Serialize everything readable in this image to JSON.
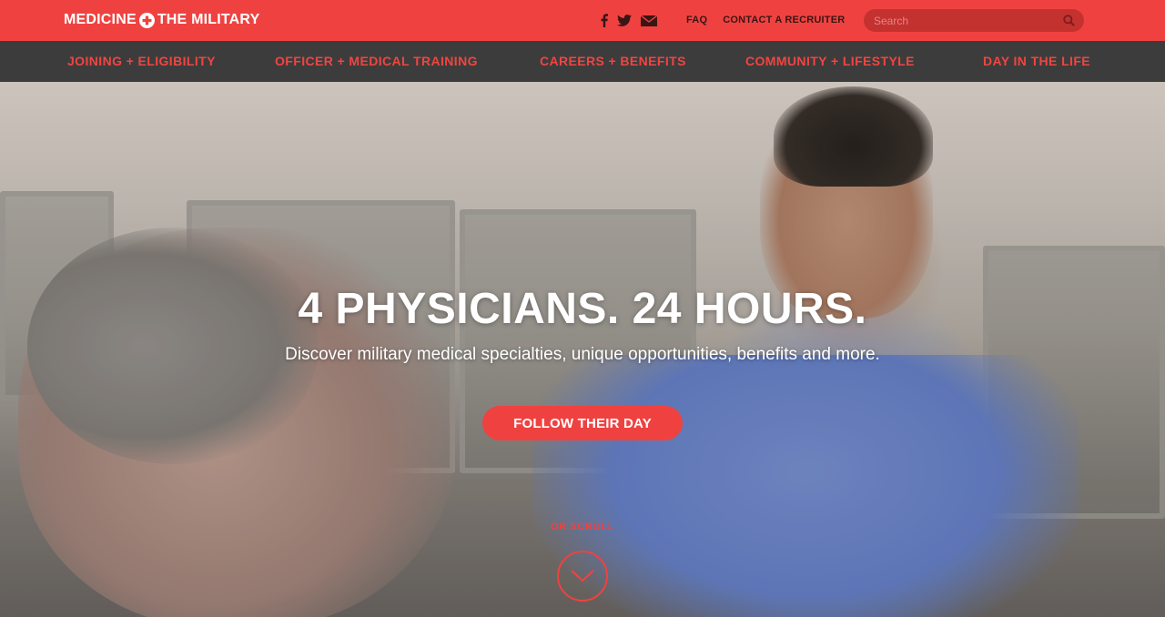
{
  "brand": {
    "logo_left": "MEDICINE",
    "logo_right": "THE MILITARY"
  },
  "header": {
    "social": [
      {
        "icon": "facebook-icon"
      },
      {
        "icon": "twitter-icon"
      },
      {
        "icon": "email-icon"
      }
    ],
    "links": {
      "faq": "FAQ",
      "contact": "CONTACT A RECRUITER"
    },
    "search": {
      "placeholder": "Search",
      "value": ""
    }
  },
  "nav": {
    "items": [
      {
        "label": "JOINING + ELIGIBILITY"
      },
      {
        "label": "OFFICER + MEDICAL TRAINING"
      },
      {
        "label": "CAREERS + BENEFITS"
      },
      {
        "label": "COMMUNITY + LIFESTYLE"
      },
      {
        "label": "DAY IN THE LIFE"
      }
    ]
  },
  "hero": {
    "title": "4 PHYSICIANS. 24 HOURS.",
    "subtitle": "Discover military medical specialties, unique opportunities, benefits and more.",
    "cta_label": "FOLLOW THEIR DAY",
    "scroll_label": "OR SCROLL"
  },
  "colors": {
    "accent": "#ef4240",
    "nav_bg": "#3c3c3c",
    "search_bg": "#c43230"
  }
}
